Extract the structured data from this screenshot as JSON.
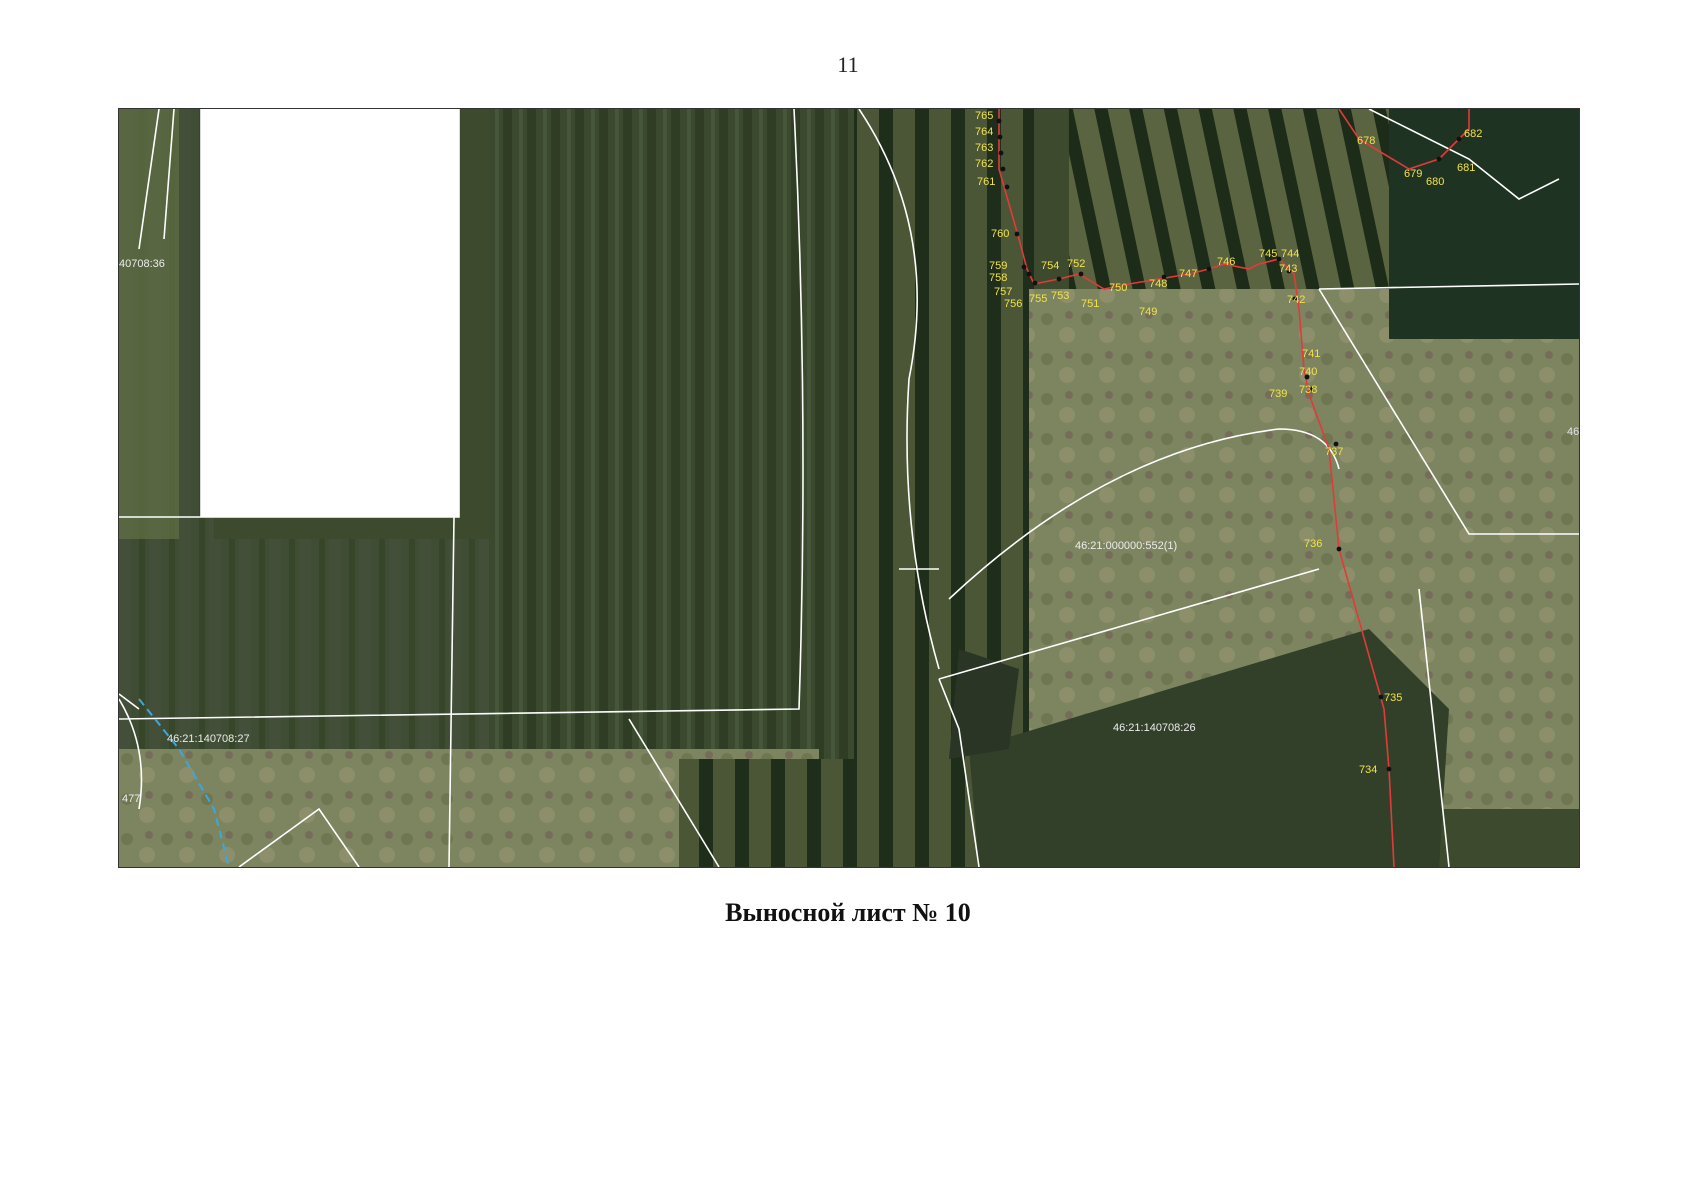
{
  "page": {
    "number": "11"
  },
  "caption": "Выносной лист № 10",
  "colors": {
    "boundary": "#ffffff",
    "red_line": "#e23a3a",
    "blue_line": "#3aa7e0",
    "point_label": "#f2e24a",
    "point_dot": "#111111"
  },
  "parcels": [
    {
      "id": "parcel-36",
      "label": "40708:36"
    },
    {
      "id": "parcel-552",
      "label": "46:21:000000:552(1)"
    },
    {
      "id": "parcel-27",
      "label": "46:21:140708:27"
    },
    {
      "id": "parcel-26",
      "label": "46:21:140708:26"
    },
    {
      "id": "parcel-477",
      "label": "477"
    },
    {
      "id": "parcel-edge",
      "label": "46"
    }
  ],
  "points": {
    "p765": "765",
    "p764": "764",
    "p763": "763",
    "p762": "762",
    "p761": "761",
    "p760": "760",
    "p759": "759",
    "p758": "758",
    "p757": "757",
    "p756": "756",
    "p755": "755",
    "p754": "754",
    "p753": "753",
    "p752": "752",
    "p751": "751",
    "p750": "750",
    "p749": "749",
    "p748": "748",
    "p747": "747",
    "p746": "746",
    "p745": "745",
    "p744": "744",
    "p743": "743",
    "p742": "742",
    "p741": "741",
    "p740": "740",
    "p739": "739",
    "p738": "738",
    "p737": "737",
    "p736": "736",
    "p735": "735",
    "p734": "734",
    "p678": "678",
    "p679": "679",
    "p680": "680",
    "p681": "681",
    "p682": "682"
  }
}
